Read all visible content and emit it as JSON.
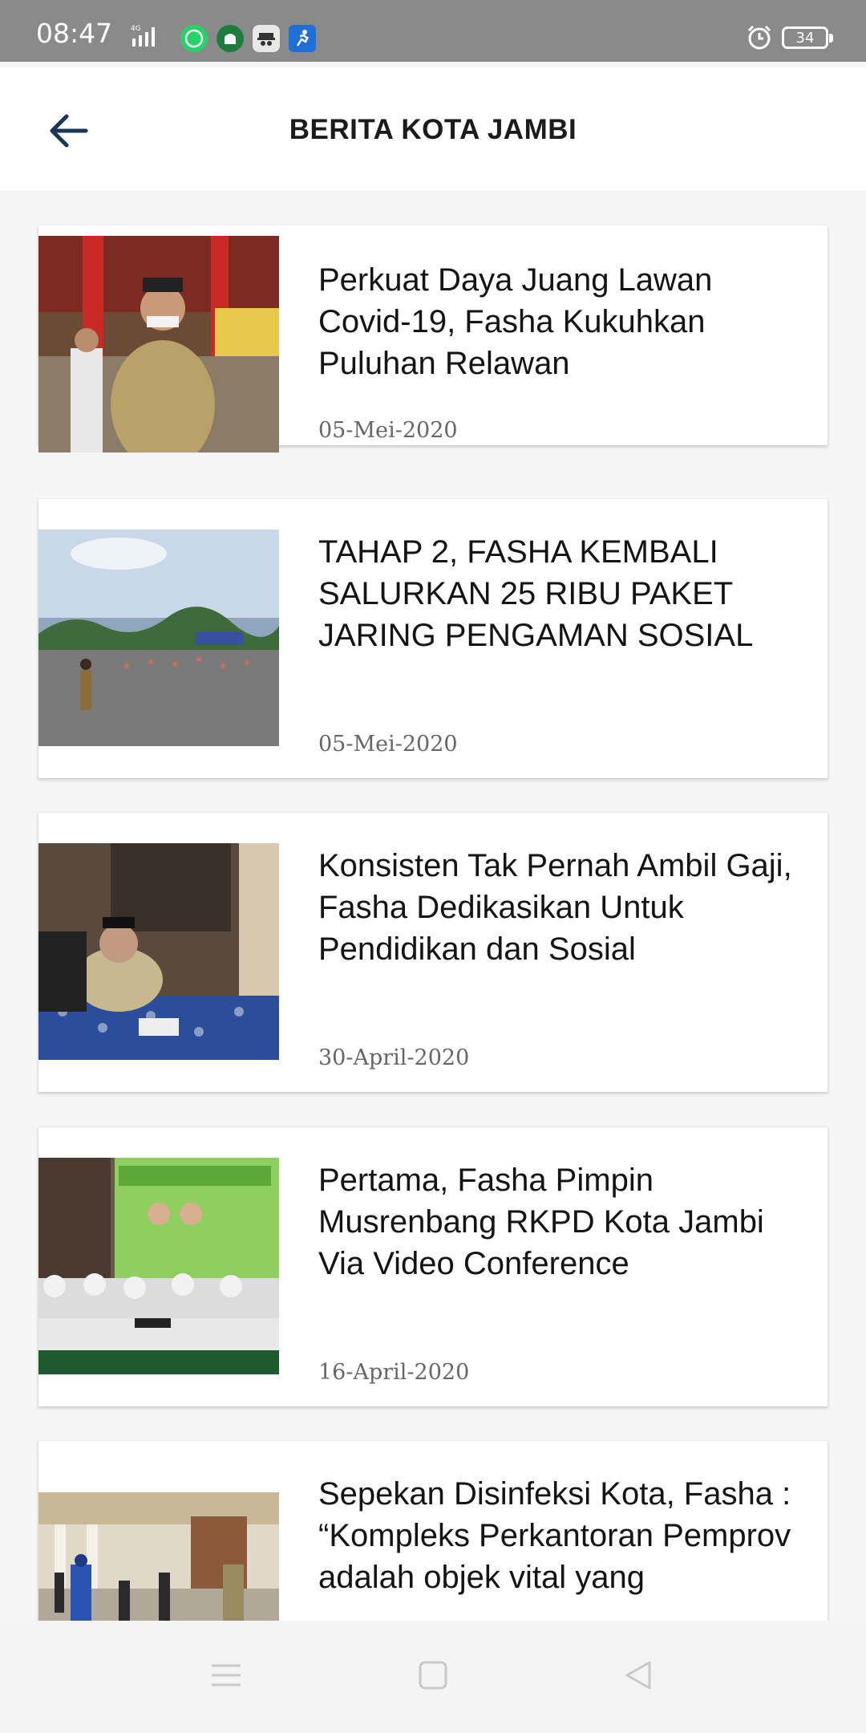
{
  "status_bar": {
    "time": "08:47",
    "network": "4G",
    "battery": "34",
    "app_icons": [
      "whatsapp-icon",
      "mosque-app-icon",
      "spy-app-icon",
      "runner-app-icon"
    ]
  },
  "app_bar": {
    "title": "BERITA KOTA JAMBI"
  },
  "news": [
    {
      "title": "Perkuat Daya Juang Lawan Covid-19, Fasha Kukuhkan Puluhan Relawan",
      "date": "05-Mei-2020"
    },
    {
      "title": "TAHAP 2, FASHA KEMBALI SALURKAN 25 RIBU PAKET JARING PENGAMAN SOSIAL",
      "date": "05-Mei-2020"
    },
    {
      "title": "Konsisten Tak Pernah Ambil Gaji, Fasha Dedikasikan Untuk Pendidikan dan Sosial",
      "date": "30-April-2020"
    },
    {
      "title": "Pertama, Fasha Pimpin Musrenbang RKPD Kota Jambi Via Video Conference",
      "date": "16-April-2020"
    },
    {
      "title": "Sepekan Disinfeksi Kota, Fasha : “Kompleks Perkantoran Pemprov adalah objek vital yang",
      "date": ""
    }
  ],
  "colors": {
    "status_bar": "#8a8a8a",
    "app_bar": "#ffffff",
    "accent": "#1c3553",
    "whatsapp": "#25d366",
    "background": "#f5f5f5"
  }
}
